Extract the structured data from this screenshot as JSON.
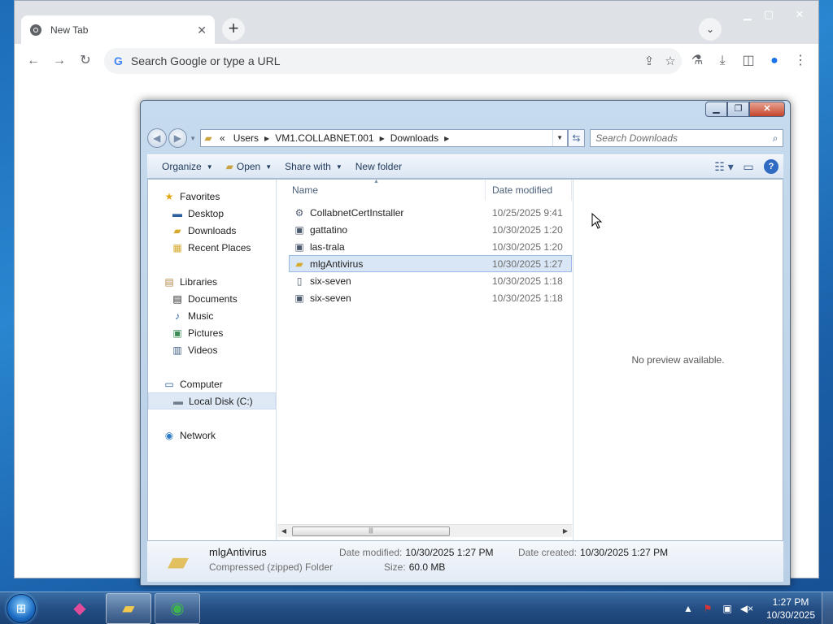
{
  "chrome": {
    "tab_title": "New Tab",
    "tab_close": "✕",
    "new_tab": "+",
    "tab_search": "⌄",
    "omnibox_g": "G",
    "omnibox_placeholder": "Search Google or type a URL",
    "nav_back": "←",
    "nav_forward": "→",
    "nav_reload": "↻",
    "win_min": "▁",
    "win_max": "▢",
    "win_close": "✕"
  },
  "explorer": {
    "breadcrumbs": [
      "Users",
      "VM1.COLLABNET.001",
      "Downloads"
    ],
    "breadcrumb_prefix": "«",
    "search_placeholder": "Search Downloads",
    "commands": {
      "organize": "Organize",
      "open": "Open",
      "share_with": "Share with",
      "new_folder": "New folder"
    },
    "nav_pane": {
      "favorites": "Favorites",
      "desktop": "Desktop",
      "downloads": "Downloads",
      "recent_places": "Recent Places",
      "libraries": "Libraries",
      "documents": "Documents",
      "music": "Music",
      "pictures": "Pictures",
      "videos": "Videos",
      "computer": "Computer",
      "local_disk": "Local Disk (C:)",
      "network": "Network"
    },
    "columns": {
      "name": "Name",
      "date_modified": "Date modified"
    },
    "files": [
      {
        "name": "CollabnetCertInstaller",
        "date": "10/25/2025 9:41",
        "icon": "installer-icon"
      },
      {
        "name": "gattatino",
        "date": "10/30/2025 1:20",
        "icon": "batch-file-icon"
      },
      {
        "name": "las-trala",
        "date": "10/30/2025 1:20",
        "icon": "batch-file-icon"
      },
      {
        "name": "mlgAntivirus",
        "date": "10/30/2025 1:27",
        "icon": "zip-folder-icon",
        "selected": true
      },
      {
        "name": "six-seven",
        "date": "10/30/2025 1:18",
        "icon": "blank-file-icon"
      },
      {
        "name": "six-seven",
        "date": "10/30/2025 1:18",
        "icon": "batch-file-icon"
      }
    ],
    "preview_text": "No preview available.",
    "details": {
      "name": "mlgAntivirus",
      "type": "Compressed (zipped) Folder",
      "date_modified_label": "Date modified:",
      "date_modified_value": "10/30/2025 1:27 PM",
      "size_label": "Size:",
      "size_value": "60.0 MB",
      "date_created_label": "Date created:",
      "date_created_value": "10/30/2025 1:27 PM"
    }
  },
  "taskbar": {
    "time": "1:27 PM",
    "date": "10/30/2025"
  }
}
